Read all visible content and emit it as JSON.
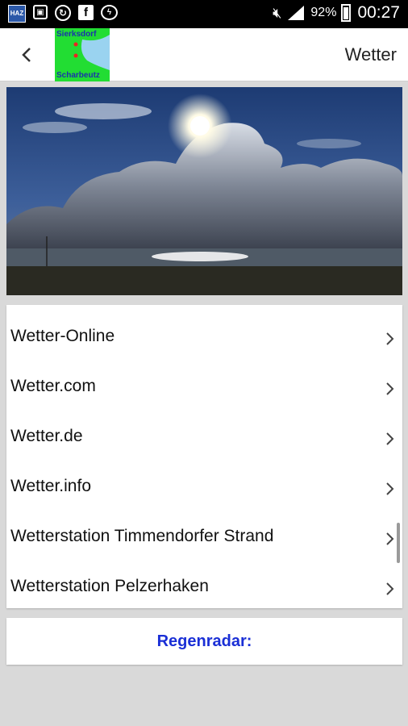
{
  "status_bar": {
    "icons": [
      "haz-app-icon",
      "screenshot-icon",
      "sync-icon",
      "facebook-icon",
      "messenger-icon"
    ],
    "haz_label": "HAZ",
    "battery": "92%",
    "time": "00:27"
  },
  "app_bar": {
    "title": "Wetter",
    "logo": {
      "top_text": "Sierksdorf",
      "bottom_text": "Scharbeutz"
    }
  },
  "links": [
    {
      "label": "Wetter-Online"
    },
    {
      "label": "Wetter.com"
    },
    {
      "label": "Wetter.de"
    },
    {
      "label": "Wetter.info"
    },
    {
      "label": "Wetterstation Timmendorfer Strand"
    },
    {
      "label": "Wetterstation Pelzerhaken"
    }
  ],
  "regenradar": {
    "label": "Regenradar:"
  },
  "colors": {
    "accent_link": "#1a2fd6",
    "logo_bg": "#22dd33",
    "background": "#d9d9d9"
  }
}
